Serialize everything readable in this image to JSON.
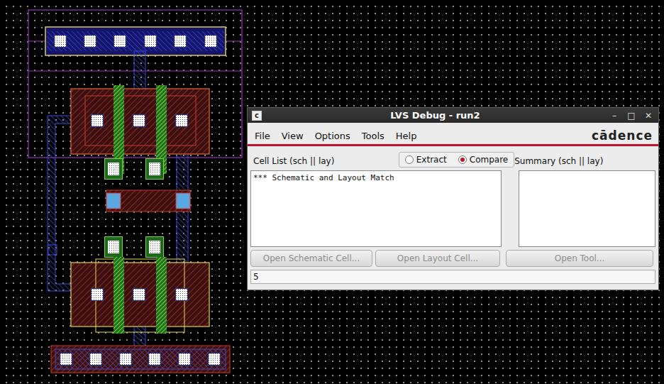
{
  "window": {
    "title": "LVS Debug - run2",
    "app_icon": "c",
    "controls": [
      "–",
      "□",
      "✕"
    ]
  },
  "menu": [
    "File",
    "View",
    "Options",
    "Tools",
    "Help"
  ],
  "logo": "cādence",
  "mode": [
    {
      "label": "Extract",
      "selected": false
    },
    {
      "label": "Compare",
      "selected": true
    }
  ],
  "cell_list": {
    "label": "Cell List (sch || lay)",
    "items": [
      "*** Schematic and Layout Match"
    ]
  },
  "summary": {
    "label": "Summary (sch || lay)",
    "items": []
  },
  "buttons": [
    {
      "label": "Open Schematic Cell...",
      "disabled": true
    },
    {
      "label": "Open Layout Cell...",
      "disabled": true
    },
    {
      "label": "Open Tool...",
      "disabled": true
    }
  ],
  "status_bar": "5"
}
